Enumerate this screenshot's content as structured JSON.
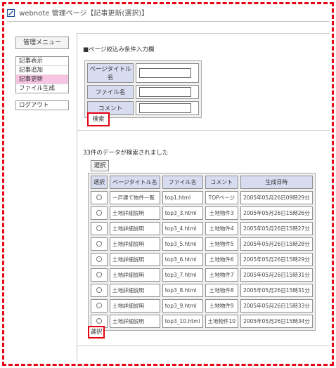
{
  "window": {
    "app_name": "webnote",
    "title": "管理ページ【記事更新(選択)】"
  },
  "sidebar": {
    "header": "管理メニュー",
    "items": [
      {
        "label": "記事表示"
      },
      {
        "label": "記事追加"
      },
      {
        "label": "記事更新",
        "active": true
      },
      {
        "label": "ファイル生成"
      }
    ],
    "logout": "ログアウト"
  },
  "filter": {
    "section_label": "■ページ絞込み条件入力欄",
    "fields": [
      {
        "label": "ページタイトル名",
        "value": ""
      },
      {
        "label": "ファイル名",
        "value": ""
      },
      {
        "label": "コメント",
        "value": ""
      }
    ],
    "search_button": "検索"
  },
  "results": {
    "message": "33件のデータが検索されました",
    "select_button_top": "選択",
    "columns": [
      "選択",
      "ページタイトル名",
      "ファイル名",
      "コメント",
      "生成日時"
    ],
    "rows": [
      {
        "title": "一戸建て物件一覧",
        "file": "top1.html",
        "comment": "TOPページ",
        "date": "2005年05月26日09時29分"
      },
      {
        "title": "土地詳細説明",
        "file": "top3_3.html",
        "comment": "土地物件3",
        "date": "2005年05月26日15時26分"
      },
      {
        "title": "土地詳細説明",
        "file": "top3_4.html",
        "comment": "土地物件4",
        "date": "2005年05月26日15時27分"
      },
      {
        "title": "土地詳細説明",
        "file": "top3_5.html",
        "comment": "土地物件5",
        "date": "2005年05月26日15時28分"
      },
      {
        "title": "土地詳細説明",
        "file": "top3_6.html",
        "comment": "土地物件6",
        "date": "2005年05月26日15時29分"
      },
      {
        "title": "土地詳細説明",
        "file": "top3_7.html",
        "comment": "土地物件7",
        "date": "2005年05月26日15時31分"
      },
      {
        "title": "土地詳細説明",
        "file": "top3_8.html",
        "comment": "土地物件8",
        "date": "2005年05月26日15時31分"
      },
      {
        "title": "土地詳細説明",
        "file": "top3_9.html",
        "comment": "土地物件9",
        "date": "2005年05月26日15時33分"
      },
      {
        "title": "土地詳細説明",
        "file": "top3_10.html",
        "comment": "土地物件10",
        "date": "2005年05月26日15時34分"
      }
    ],
    "select_button_bottom": "選択"
  },
  "colors": {
    "highlight_border": "#e60012",
    "active_menu": "#f7c4e2",
    "header_cell": "#d8dcf0"
  }
}
